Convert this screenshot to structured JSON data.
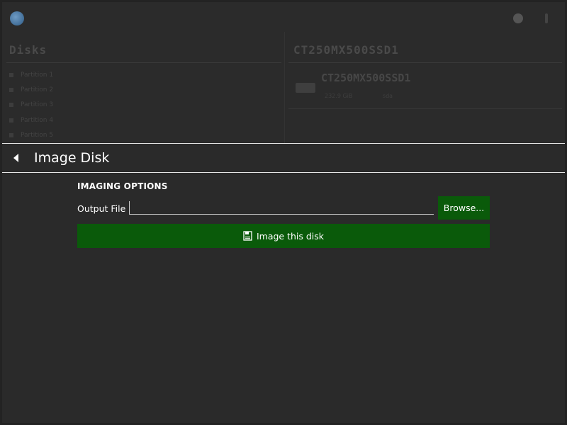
{
  "background_app": {
    "left_section_title": "Disks",
    "left_list": [
      "Partition 1",
      "Partition 2",
      "Partition 3",
      "Partition 4",
      "Partition 5"
    ],
    "right_section_title": "CT250MX500SSD1",
    "disk_name": "CT250MX500SSD1",
    "disk_meta": [
      "232.9 GiB",
      "sda"
    ]
  },
  "panel": {
    "title": "Image Disk",
    "back_icon": "chevron-left-icon"
  },
  "imaging": {
    "section_title": "IMAGING OPTIONS",
    "output_label": "Output File",
    "output_value": "",
    "browse_label": "Browse...",
    "image_button_label": "Image this disk",
    "image_button_icon": "disk-image-icon"
  },
  "colors": {
    "accent_green": "#0a5a0a",
    "background": "#2a2a2a",
    "text": "#ffffff"
  }
}
